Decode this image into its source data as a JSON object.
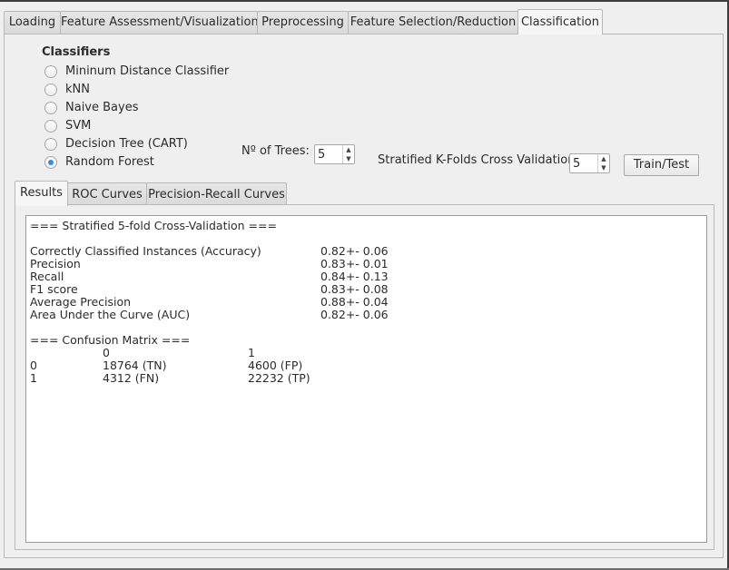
{
  "main_tabs": [
    "Loading",
    "Feature Assessment/Visualization",
    "Preprocessing",
    "Feature Selection/Reduction",
    "Classification"
  ],
  "classifiers": {
    "title": "Classifiers",
    "options": [
      {
        "label": "Mininum Distance Classifier",
        "checked": false
      },
      {
        "label": "kNN",
        "checked": false
      },
      {
        "label": "Naive Bayes",
        "checked": false
      },
      {
        "label": "SVM",
        "checked": false
      },
      {
        "label": "Decision Tree (CART)",
        "checked": false
      },
      {
        "label": "Random Forest",
        "checked": true
      }
    ]
  },
  "trees": {
    "label": "Nº of Trees:",
    "value": "5"
  },
  "kfolds": {
    "label": "Stratified K-Folds Cross Validation:",
    "value": "5"
  },
  "train_button": "Train/Test",
  "result_tabs": [
    "Results",
    "ROC Curves",
    "Precision-Recall Curves"
  ],
  "results": {
    "header": "=== Stratified 5-fold Cross-Validation ===",
    "metrics": [
      {
        "name": "Correctly Classified Instances (Accuracy)",
        "value": "0.82+- 0.06"
      },
      {
        "name": "Precision",
        "value": "0.83+- 0.01"
      },
      {
        "name": "Recall",
        "value": "0.84+- 0.13"
      },
      {
        "name": "F1 score",
        "value": "0.83+- 0.08"
      },
      {
        "name": "Average Precision",
        "value": "0.88+- 0.04"
      },
      {
        "name": "Area Under the Curve (AUC)",
        "value": "0.82+- 0.06"
      }
    ],
    "confusion_header": "=== Confusion Matrix ===",
    "confusion_cols": [
      "0",
      "1"
    ],
    "confusion_rows": [
      {
        "label": "0",
        "c0": "18764 (TN)",
        "c1": "4600 (FP)"
      },
      {
        "label": "1",
        "c0": "4312 (FN)",
        "c1": "22232 (TP)"
      }
    ]
  },
  "colors": {
    "accent": "#3a8ed8",
    "window_bg": "#efefef"
  }
}
